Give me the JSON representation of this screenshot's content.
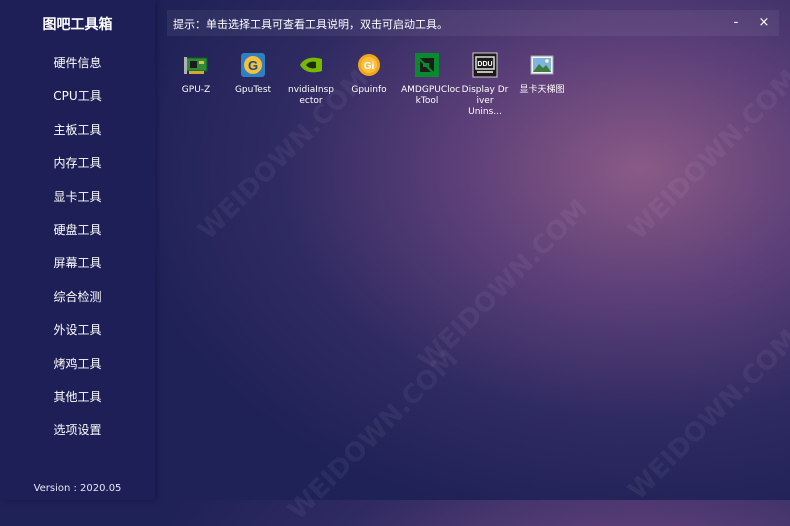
{
  "app": {
    "title": "图吧工具箱",
    "version": "Version : 2020.05"
  },
  "sidebar": {
    "items": [
      {
        "label": "硬件信息"
      },
      {
        "label": "CPU工具"
      },
      {
        "label": "主板工具"
      },
      {
        "label": "内存工具"
      },
      {
        "label": "显卡工具"
      },
      {
        "label": "硬盘工具"
      },
      {
        "label": "屏幕工具"
      },
      {
        "label": "综合检测"
      },
      {
        "label": "外设工具"
      },
      {
        "label": "烤鸡工具"
      },
      {
        "label": "其他工具"
      },
      {
        "label": "选项设置"
      }
    ]
  },
  "hint": {
    "text": "提示：单击选择工具可查看工具说明，双击可启动工具。"
  },
  "window_controls": {
    "minimize": "-",
    "close": "×"
  },
  "tools": [
    {
      "label": "GPU-Z",
      "icon": "gpu-card-icon"
    },
    {
      "label": "GpuTest",
      "icon": "gputest-icon"
    },
    {
      "label": "nvidiaInsp\nector",
      "icon": "nvidia-icon"
    },
    {
      "label": "Gpuinfo",
      "icon": "gpuinfo-gear-icon"
    },
    {
      "label": "AMDGPUCloc\nkTool",
      "icon": "amd-icon"
    },
    {
      "label": "Display Dr\niver Unins...",
      "icon": "ddu-icon"
    },
    {
      "label": "显卡天梯图",
      "icon": "image-file-icon"
    }
  ],
  "watermark": {
    "text": "WEIDOWN.COM"
  },
  "colors": {
    "sidebar": "#1e1f57",
    "accent_nvidia": "#76b900",
    "amd_green": "#0a8a2e"
  }
}
